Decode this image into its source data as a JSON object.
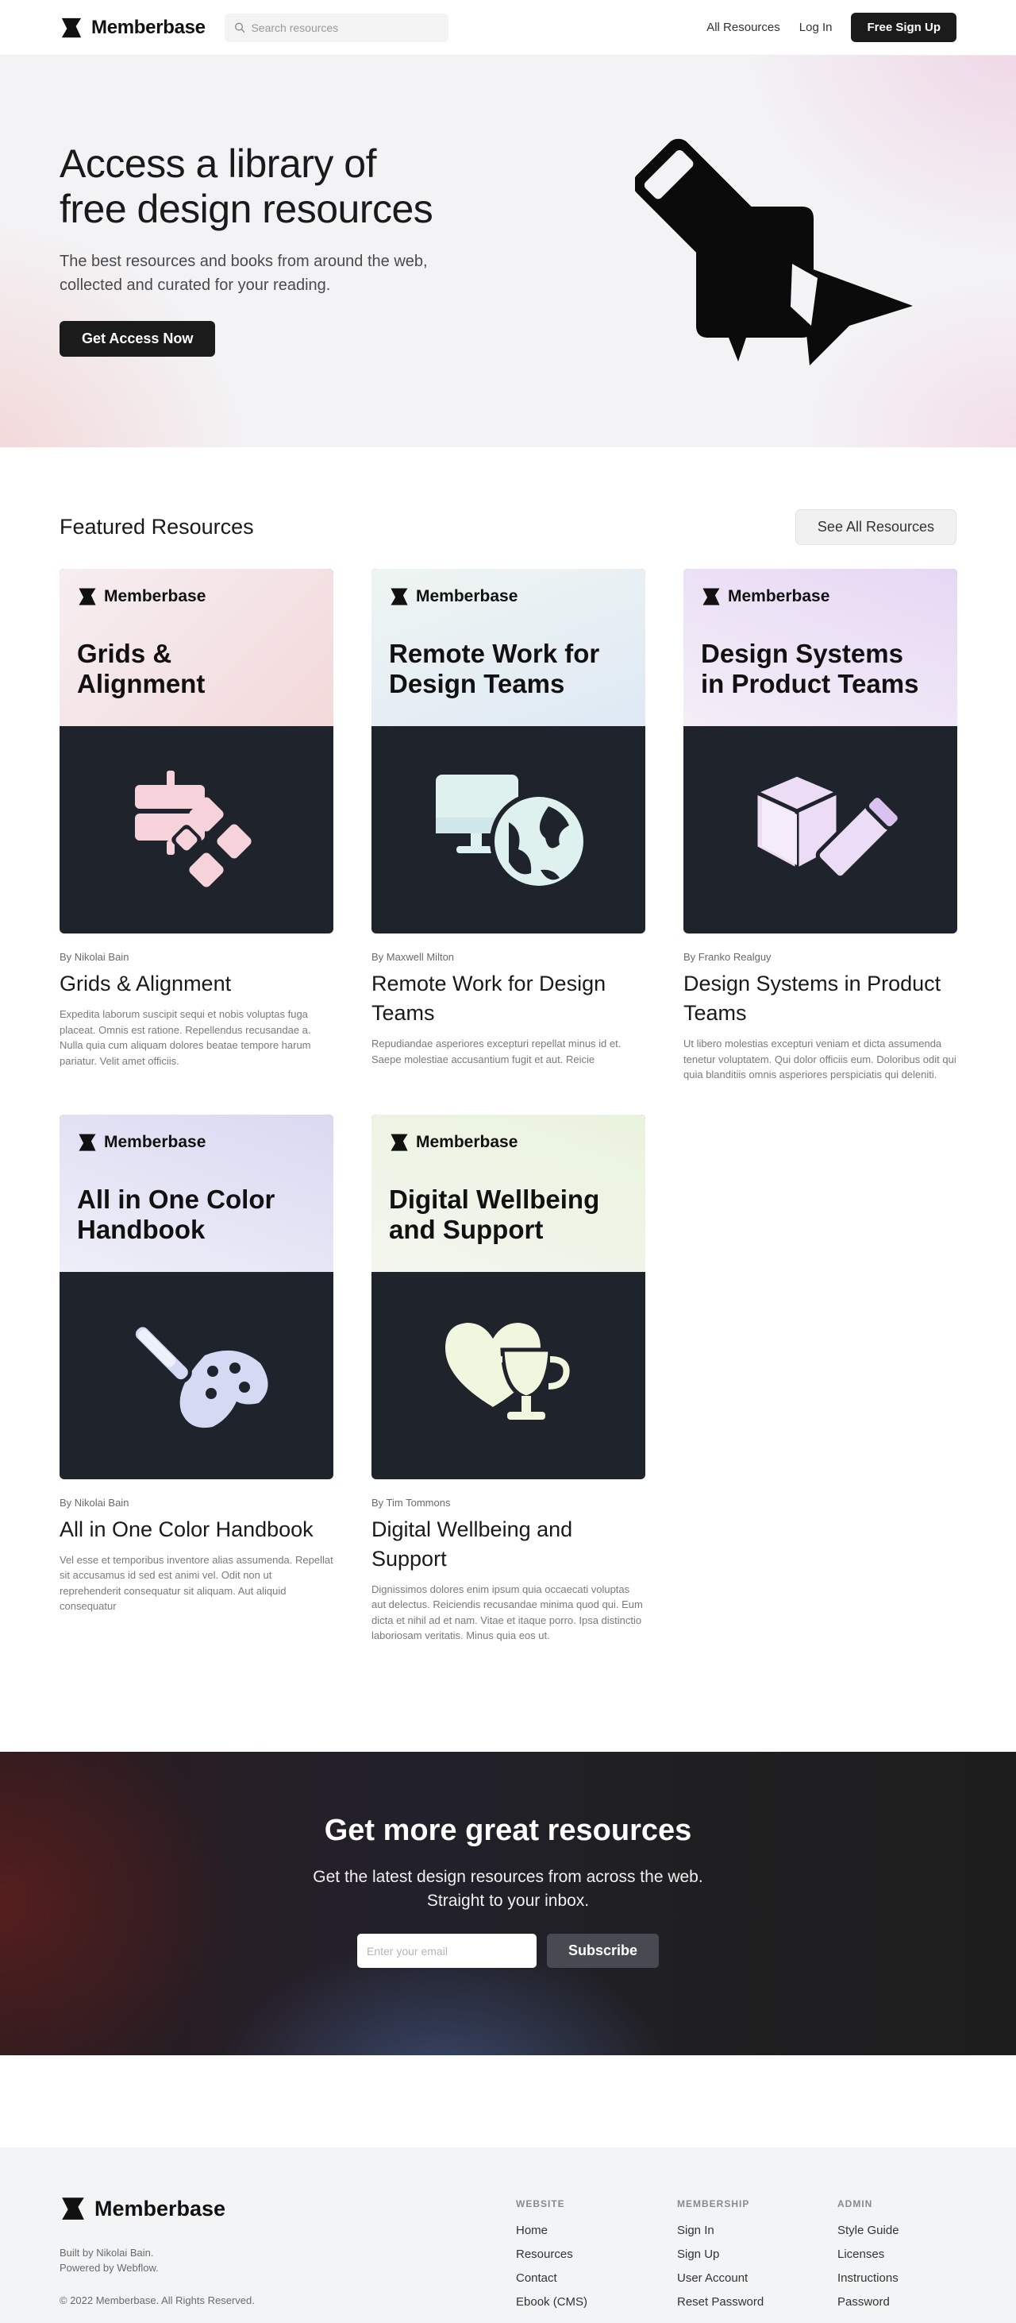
{
  "nav": {
    "brand": "Memberbase",
    "search_placeholder": "Search resources",
    "links": [
      "All Resources",
      "Log In"
    ],
    "cta": "Free Sign Up"
  },
  "hero": {
    "title_line1": "Access a library of",
    "title_line2": "free design resources",
    "subtitle_line1": "The best resources and books from around the web,",
    "subtitle_line2": "collected and curated for your reading.",
    "cta": "Get Access Now"
  },
  "featured": {
    "title": "Featured Resources",
    "see_all": "See All Resources",
    "cards": [
      {
        "cover_brand": "Memberbase",
        "cover_title_1": "Grids &",
        "cover_title_2": "Alignment",
        "author": "By Nikolai Bain",
        "title": "Grids & Alignment",
        "description": "Expedita laborum suscipit sequi et nobis voluptas fuga placeat. Omnis est ratione. Repellendus recusandae a. Nulla quia cum aliquam dolores beatae tempore harum pariatur. Velit amet officiis.",
        "icon": "grid-diamonds-icon",
        "gradient_start": "#f3d9da",
        "gradient_end": "#f6eef1",
        "icon_color": "#f6d3da"
      },
      {
        "cover_brand": "Memberbase",
        "cover_title_1": "Remote Work for",
        "cover_title_2": "Design Teams",
        "author": "By Maxwell Milton",
        "title": "Remote Work for Design Teams",
        "description": "Repudiandae asperiores excepturi repellat minus id et. Saepe molestiae accusantium fugit et aut. Reicie",
        "icon": "monitor-globe-icon",
        "gradient_start": "#dfe9f4",
        "gradient_end": "#eef5f2",
        "icon_color": "#def1ef"
      },
      {
        "cover_brand": "Memberbase",
        "cover_title_1": "Design Systems",
        "cover_title_2": "in Product Teams",
        "author": "By Franko Realguy",
        "title": "Design Systems in Product Teams",
        "description": "Ut libero molestias excepturi veniam et dicta assumenda tenetur voluptatem. Qui dolor officiis eum. Doloribus odit qui quia blanditiis omnis asperiores perspiciatis qui deleniti.",
        "icon": "cube-pencil-icon",
        "gradient_start": "#e6d8f5",
        "gradient_end": "#f4eef6",
        "icon_color": "#ecdcf6"
      },
      {
        "cover_brand": "Memberbase",
        "cover_title_1": "All in One Color",
        "cover_title_2": "Handbook",
        "author": "By Nikolai Bain",
        "title": "All in One Color Handbook",
        "description": "Vel esse et temporibus inventore alias assumenda. Repellat sit accusamus id sed est animi vel. Odit non ut reprehenderit consequatur sit aliquam. Aut aliquid consequatur",
        "icon": "brush-palette-icon",
        "gradient_start": "#dad9f2",
        "gradient_end": "#eeeef8",
        "icon_color": "#d5daf4"
      },
      {
        "cover_brand": "Memberbase",
        "cover_title_1": "Digital Wellbeing",
        "cover_title_2": "and Support",
        "author": "By Tim Tommons",
        "title": "Digital Wellbeing and Support",
        "description": "Dignissimos dolores enim ipsum quia occaecati voluptas aut delectus. Reiciendis recusandae minima quod qui. Eum dicta et nihil ad et nam. Vitae et itaque porro. Ipsa distinctio laboriosam veritatis. Minus quia eos ut.",
        "icon": "heart-trophy-icon",
        "gradient_start": "#eaf3de",
        "gradient_end": "#f3f5ee",
        "icon_color": "#f1f6df"
      }
    ]
  },
  "newsletter": {
    "title": "Get more great resources",
    "subtitle_line1": "Get the latest design resources from across the web.",
    "subtitle_line2": "Straight to your inbox.",
    "email_placeholder": "Enter your email",
    "subscribe": "Subscribe"
  },
  "footer": {
    "brand": "Memberbase",
    "built_by": "Built by Nikolai Bain.",
    "powered_by": "Powered by Webflow.",
    "copyright": "© 2022 Memberbase. All Rights Reserved.",
    "columns": [
      {
        "heading": "WEBSITE",
        "links": [
          "Home",
          "Resources",
          "Contact",
          "Ebook (CMS)"
        ]
      },
      {
        "heading": "MEMBERSHIP",
        "links": [
          "Sign In",
          "Sign Up",
          "User Account",
          "Reset Password"
        ]
      },
      {
        "heading": "ADMIN",
        "links": [
          "Style Guide",
          "Licenses",
          "Instructions",
          "Password"
        ]
      }
    ]
  }
}
